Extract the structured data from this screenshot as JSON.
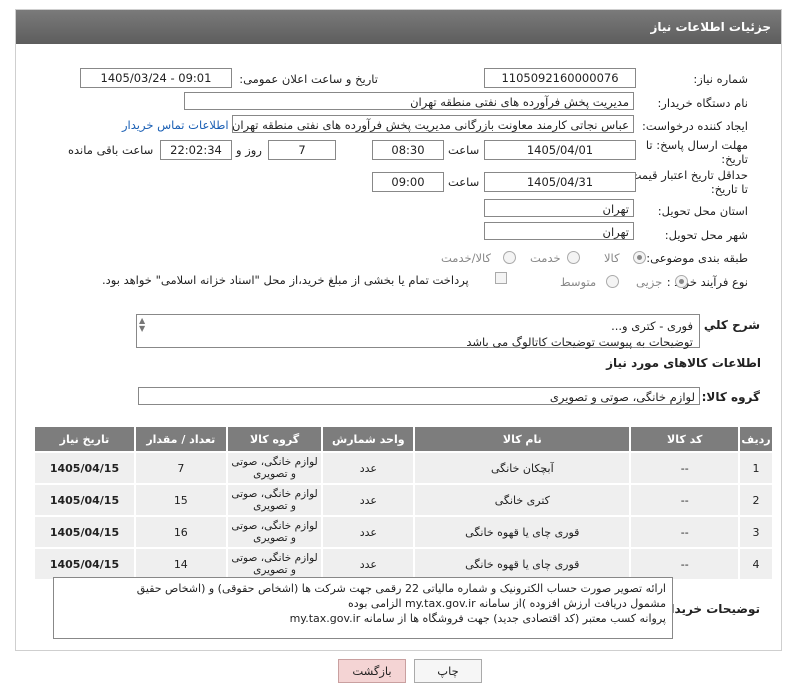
{
  "panel": {
    "title": "جزئیات اطلاعات نیاز"
  },
  "watermark": {
    "text": "AriaTender.neT"
  },
  "form": {
    "need_number_label": "شماره نیاز:",
    "need_number": "1105092160000076",
    "announce_label": "تاریخ و ساعت اعلان عمومی:",
    "announce_value": "1405/03/24 - 09:01",
    "buyer_org_label": "نام دستگاه خریدار:",
    "buyer_org": "مدیریت پخش فرآورده های نفتی منطقه تهران",
    "requester_label": "ایجاد کننده درخواست:",
    "requester": "عباس نجاتی کارمند معاونت بازرگانی مدیریت پخش فرآورده های نفتی منطقه تهران",
    "buyer_contact_link": "اطلاعات تماس خریدار",
    "deadline_label_1": "مهلت ارسال پاسخ: تا",
    "deadline_label_2": "تاریخ:",
    "deadline_date": "1405/04/01",
    "time_label": "ساعت",
    "deadline_time": "08:30",
    "days_value": "7",
    "days_label": "روز و",
    "remaining_time": "22:02:34",
    "remaining_label": "ساعت باقی مانده",
    "validity_label_1": "حداقل تاریخ اعتبار قیمت:",
    "validity_label_2": "تا تاریخ:",
    "validity_date": "1405/04/31",
    "validity_time": "09:00",
    "province_label": "استان محل تحویل:",
    "province": "تهران",
    "city_label": "شهر محل تحویل:",
    "city": "تهران",
    "category_label": "طبقه بندی موضوعی:",
    "category_options": [
      "کالا",
      "خدمت",
      "کالا/خدمت"
    ],
    "category_selected": "کالا",
    "process_label": "نوع فرآیند خرید :",
    "process_options": [
      "جزیی",
      "متوسط"
    ],
    "process_selected": "جزیی",
    "payment_text": "پرداخت تمام یا بخشی از مبلغ خرید،از محل \"اسناد خزانه اسلامی\" خواهد بود."
  },
  "description": {
    "label": "شرح کلي نياز:",
    "line1": "فوری - کتری و...",
    "line2": "توضیحات به پیوست توضیحات کاتالوگ می باشد"
  },
  "goods": {
    "section_title": "اطلاعات کالاهای مورد نیاز",
    "group_label": "گروه کالا:",
    "group_value": "لوازم خانگی، صوتی و تصویری",
    "columns": [
      "ردیف",
      "کد کالا",
      "نام کالا",
      "واحد شمارش",
      "گروه کالا",
      "تعداد / مقدار",
      "تاریخ نیاز"
    ],
    "rows": [
      {
        "row": "1",
        "code": "--",
        "name": "آبچکان خانگی",
        "unit": "عدد",
        "group": "لوازم خانگی، صوتی و تصویری",
        "qty": "7",
        "date": "1405/04/15"
      },
      {
        "row": "2",
        "code": "--",
        "name": "کتری خانگی",
        "unit": "عدد",
        "group": "لوازم خانگی، صوتی و تصویری",
        "qty": "15",
        "date": "1405/04/15"
      },
      {
        "row": "3",
        "code": "--",
        "name": "قوری چای یا قهوه خانگی",
        "unit": "عدد",
        "group": "لوازم خانگی، صوتی و تصویری",
        "qty": "16",
        "date": "1405/04/15"
      },
      {
        "row": "4",
        "code": "--",
        "name": "قوری چای یا قهوه خانگی",
        "unit": "عدد",
        "group": "لوازم خانگی، صوتی و تصویری",
        "qty": "14",
        "date": "1405/04/15"
      }
    ]
  },
  "buyer_notes": {
    "label": "توضیحات خریدار:",
    "line1": "ارائه  تصویر صورت حساب الکترونیک و شماره مالیاتی 22 رقمی  جهت شرکت ها (اشخاص حقوقی) و (اشخاص حقیق",
    "line2": "مشمول دریافت ارزش افزوده )از سامانه my.tax.gov.ir  الزامی بوده",
    "line3": "پروانه کسب معتبر (کد اقتصادی جدید) جهت فروشگاه ها از سامانه my.tax.gov.ir"
  },
  "buttons": {
    "print": "چاپ",
    "back": "بازگشت"
  }
}
